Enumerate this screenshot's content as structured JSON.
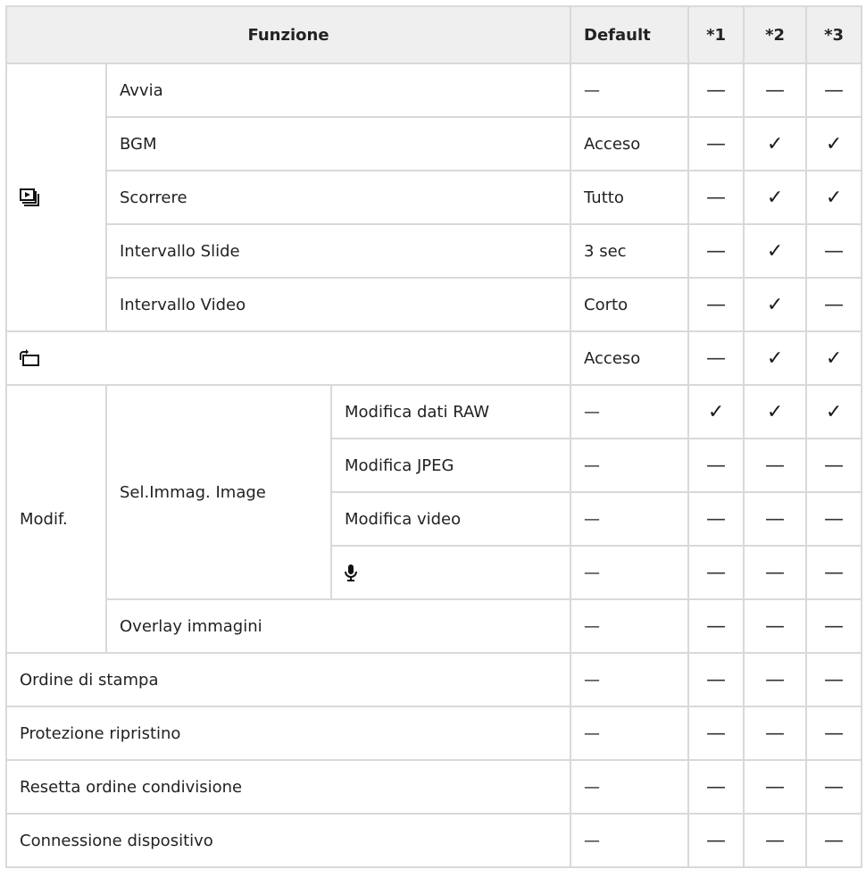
{
  "header": {
    "function": "Funzione",
    "default": "Default",
    "col1": "*1",
    "col2": "*2",
    "col3": "*3"
  },
  "symbols": {
    "dash": "—",
    "check": "✓"
  },
  "rows": {
    "avvia": {
      "label": "Avvia",
      "default": "—",
      "c1": "—",
      "c2": "—",
      "c3": "—"
    },
    "bgm": {
      "label": "BGM",
      "default": "Acceso",
      "c1": "—",
      "c2": "✓",
      "c3": "✓"
    },
    "scorrere": {
      "label": "Scorrere",
      "default": "Tutto",
      "c1": "—",
      "c2": "✓",
      "c3": "✓"
    },
    "intervallo_slide": {
      "label": "Intervallo Slide",
      "default": "3 sec",
      "c1": "—",
      "c2": "✓",
      "c3": "—"
    },
    "intervallo_video": {
      "label": "Intervallo Video",
      "default": "Corto",
      "c1": "—",
      "c2": "✓",
      "c3": "—"
    },
    "rotate": {
      "icon": "rotate-icon",
      "default": "Acceso",
      "c1": "—",
      "c2": "✓",
      "c3": "✓"
    },
    "modif_label": "Modif.",
    "sel_immag_label": "Sel.Immag. Image",
    "modifica_raw": {
      "label": "Modifica dati RAW",
      "default": "—",
      "c1": "✓",
      "c2": "✓",
      "c3": "✓"
    },
    "modifica_jpeg": {
      "label": "Modifica JPEG",
      "default": "—",
      "c1": "—",
      "c2": "—",
      "c3": "—"
    },
    "modifica_video": {
      "label": "Modifica video",
      "default": "—",
      "c1": "—",
      "c2": "—",
      "c3": "—"
    },
    "mic": {
      "icon": "microphone-icon",
      "default": "—",
      "c1": "—",
      "c2": "—",
      "c3": "—"
    },
    "overlay": {
      "label": "Overlay immagini",
      "default": "—",
      "c1": "—",
      "c2": "—",
      "c3": "—"
    },
    "ordine_stampa": {
      "label": "Ordine di stampa",
      "default": "—",
      "c1": "—",
      "c2": "—",
      "c3": "—"
    },
    "protezione": {
      "label": "Protezione ripristino",
      "default": "—",
      "c1": "—",
      "c2": "—",
      "c3": "—"
    },
    "resetta": {
      "label": "Resetta ordine condivisione",
      "default": "—",
      "c1": "—",
      "c2": "—",
      "c3": "—"
    },
    "connessione": {
      "label": "Connessione dispositivo",
      "default": "—",
      "c1": "—",
      "c2": "—",
      "c3": "—"
    }
  },
  "slideshow_group": {
    "icon": "slideshow-icon"
  }
}
